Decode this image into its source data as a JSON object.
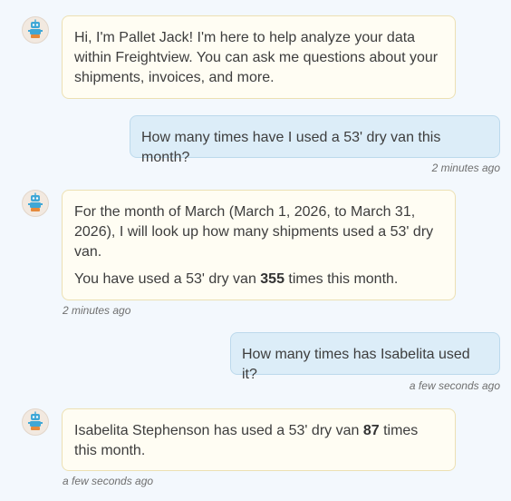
{
  "assistant": {
    "name": "Pallet Jack",
    "avatar_icon": "pallet-jack-robot-icon"
  },
  "messages": [
    {
      "role": "assistant",
      "paragraphs": [
        "Hi, I'm Pallet Jack! I'm here to help analyze your data within Freightview. You can ask me questions about your shipments, invoices, and more."
      ]
    },
    {
      "role": "user",
      "text": "How many times have I used a 53' dry van this month?",
      "timestamp": "2 minutes ago"
    },
    {
      "role": "assistant",
      "paragraph1": "For the month of March (March 1, 2026, to March 31, 2026), I will look up how many shipments used a 53' dry van.",
      "paragraph2_prefix": "You have used a 53' dry van ",
      "paragraph2_bold": "355",
      "paragraph2_suffix": " times this month.",
      "timestamp": "2 minutes ago"
    },
    {
      "role": "user",
      "text": "How many times has Isabelita used it?",
      "timestamp": "a few seconds ago"
    },
    {
      "role": "assistant",
      "prefix": "Isabelita Stephenson has used a 53' dry van ",
      "bold": "87",
      "suffix": " times this month.",
      "timestamp": "a few seconds ago"
    }
  ]
}
